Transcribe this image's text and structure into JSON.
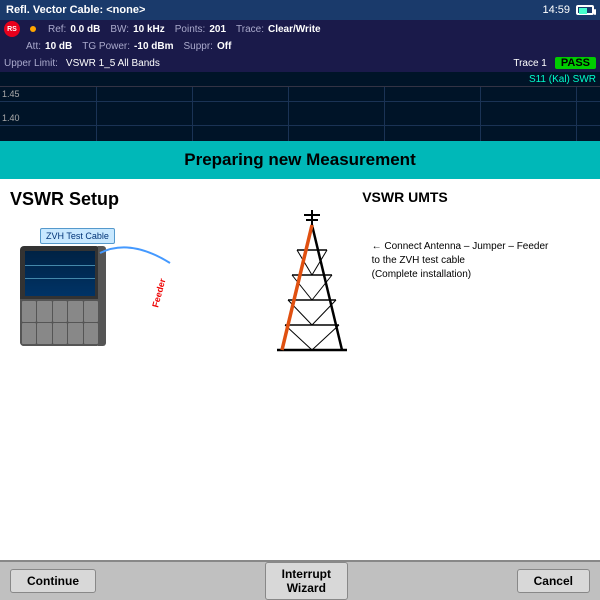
{
  "statusBar": {
    "title": "Refl. Vector  Cable: <none>",
    "time": "14:59"
  },
  "params": {
    "ref_label": "Ref:",
    "ref_value": "0.0 dB",
    "bw_label": "BW:",
    "bw_value": "10 kHz",
    "points_label": "Points:",
    "points_value": "201",
    "trace_label": "Trace:",
    "trace_value": "Clear/Write",
    "att_label": "Att:",
    "att_value": "10 dB",
    "tg_label": "TG Power:",
    "tg_value": "-10 dBm",
    "suppr_label": "Suppr:",
    "suppr_value": "Off"
  },
  "limitBar": {
    "upper_label": "Upper Limit:",
    "upper_value": "VSWR 1_5 All Bands",
    "trace_label": "Trace 1",
    "pass_text": "PASS",
    "s11_label": "S11 (Kal) SWR"
  },
  "chart": {
    "y_labels": [
      "1.45",
      "1.40"
    ]
  },
  "preparingBanner": {
    "text": "Preparing new Measurement"
  },
  "mainContent": {
    "vswr_setup_title": "VSWR Setup",
    "vswr_umts_title": "VSWR UMTS",
    "zhv_label": "ZVH Test Cable",
    "feeder_label": "Feeder",
    "connect_text": "← Connect Antenna – Jumper – Feeder\nto the ZVH test cable\n(Complete installation)"
  },
  "buttons": {
    "continue": "Continue",
    "interrupt_line1": "Interrupt",
    "interrupt_line2": "Wizard",
    "cancel": "Cancel"
  },
  "colors": {
    "accent_teal": "#00b8b8",
    "pass_green": "#00cc00",
    "s11_cyan": "#00ffcc",
    "header_blue": "#1a3a6b",
    "dark_header": "#1a1a4a"
  }
}
